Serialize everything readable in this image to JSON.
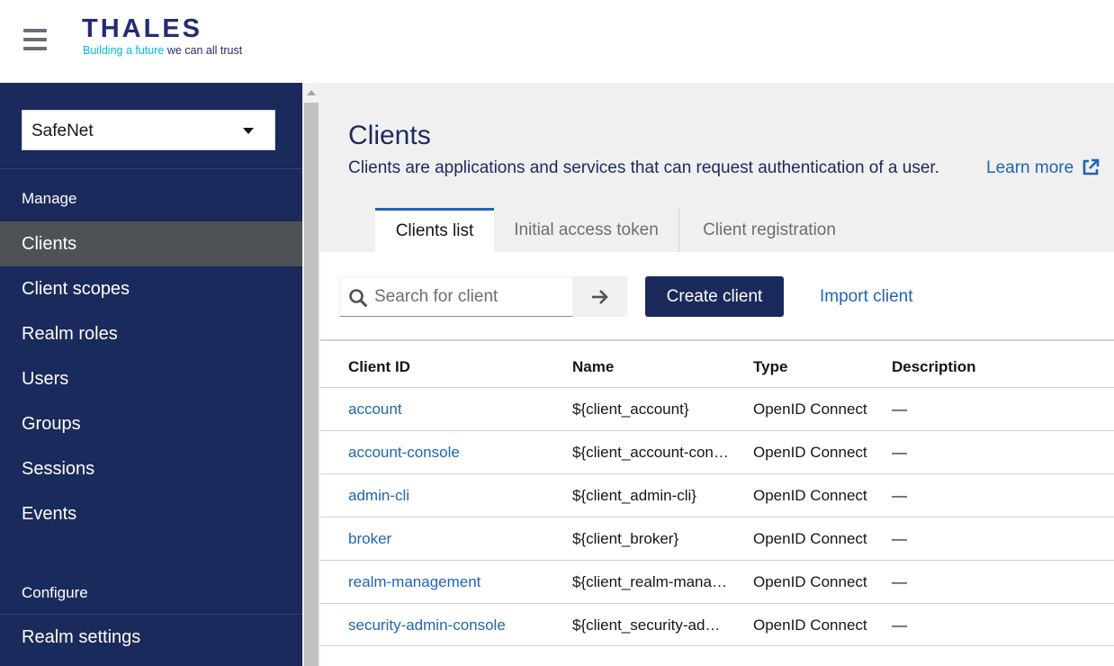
{
  "header": {
    "logo_word": "THALES",
    "logo_tag_part1": "Building a future",
    "logo_tag_part2": " we can all trust"
  },
  "sidebar": {
    "realm": "SafeNet",
    "manage_label": "Manage",
    "items": [
      "Clients",
      "Client scopes",
      "Realm roles",
      "Users",
      "Groups",
      "Sessions",
      "Events"
    ],
    "active_item": "Clients",
    "configure_label": "Configure",
    "configure_items": [
      "Realm settings"
    ]
  },
  "page": {
    "title": "Clients",
    "description": "Clients are applications and services that can request authentication of a user.",
    "learn_more": "Learn more"
  },
  "tabs": [
    "Clients list",
    "Initial access token",
    "Client registration"
  ],
  "toolbar": {
    "search_placeholder": "Search for client",
    "create_label": "Create client",
    "import_label": "Import client"
  },
  "table": {
    "columns": [
      "Client ID",
      "Name",
      "Type",
      "Description"
    ],
    "rows": [
      {
        "client_id": "account",
        "name": "${client_account}",
        "type": "OpenID Connect",
        "description": "—"
      },
      {
        "client_id": "account-console",
        "name": "${client_account-con…",
        "type": "OpenID Connect",
        "description": "—"
      },
      {
        "client_id": "admin-cli",
        "name": "${client_admin-cli}",
        "type": "OpenID Connect",
        "description": "—"
      },
      {
        "client_id": "broker",
        "name": "${client_broker}",
        "type": "OpenID Connect",
        "description": "—"
      },
      {
        "client_id": "realm-management",
        "name": "${client_realm-mana…",
        "type": "OpenID Connect",
        "description": "—"
      },
      {
        "client_id": "security-admin-console",
        "name": "${client_security-ad…",
        "type": "OpenID Connect",
        "description": "—"
      }
    ]
  },
  "colors": {
    "navy": "#1b2a5c",
    "link_blue": "#1f64b5",
    "logo_cyan": "#00bbdd",
    "active_nav": "#4f5255"
  }
}
